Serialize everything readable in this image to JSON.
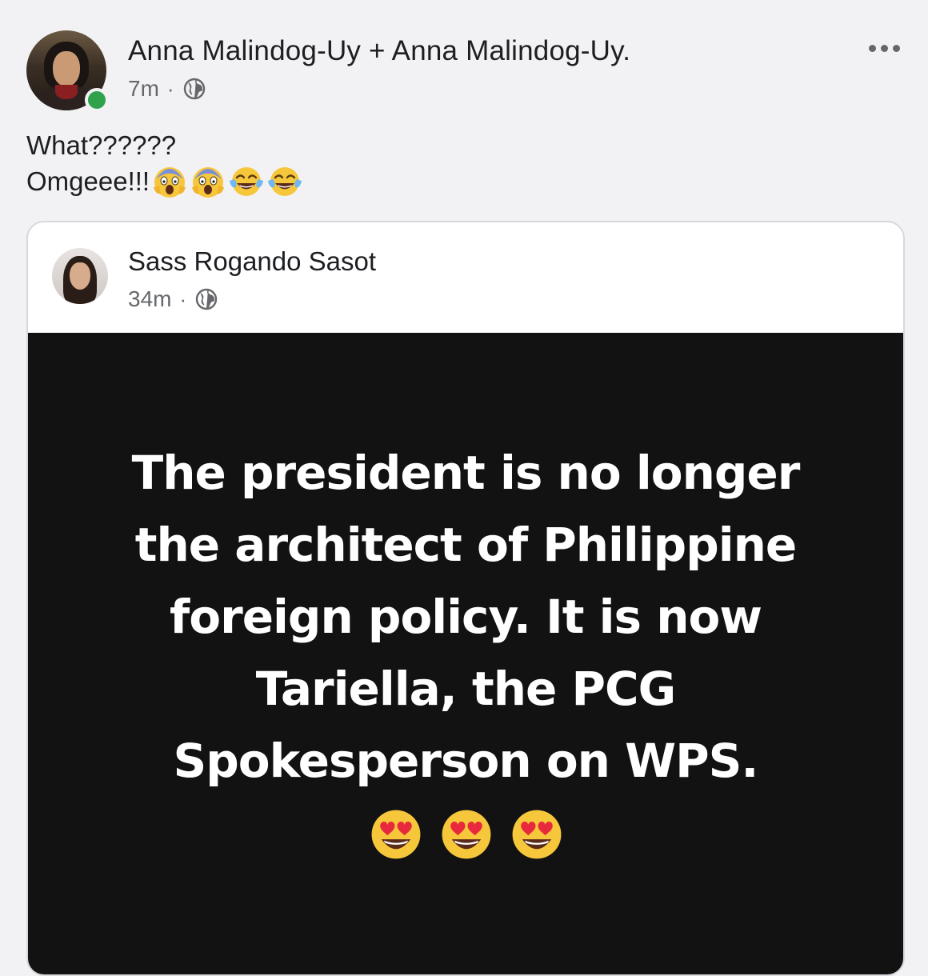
{
  "post": {
    "author": "Anna Malindog-Uy + Anna Malindog-Uy.",
    "time": "7m",
    "separator": "·",
    "privacy_icon": "globe-icon",
    "online": true,
    "more_icon": "more-options-icon",
    "text_line1": "What??????",
    "text_line2": "Omgeee!!!",
    "text_emojis": [
      "screaming-face-emoji",
      "screaming-face-emoji",
      "tears-of-joy-emoji",
      "tears-of-joy-emoji"
    ]
  },
  "shared_post": {
    "author": "Sass Rogando Sasot",
    "time": "34m",
    "separator": "·",
    "privacy_icon": "globe-icon",
    "quote_lines": [
      "The president is no longer",
      "the architect of Philippine",
      "foreign policy. It is now",
      "Tariella, the PCG",
      "Spokesperson on WPS."
    ],
    "quote_emojis": [
      "heart-eyes-emoji",
      "heart-eyes-emoji",
      "heart-eyes-emoji"
    ],
    "panel_color": "#121212"
  },
  "colors": {
    "online_green": "#31a24c",
    "secondary_text": "#65676b",
    "primary_text": "#1c1e21",
    "background": "#f2f2f4"
  }
}
